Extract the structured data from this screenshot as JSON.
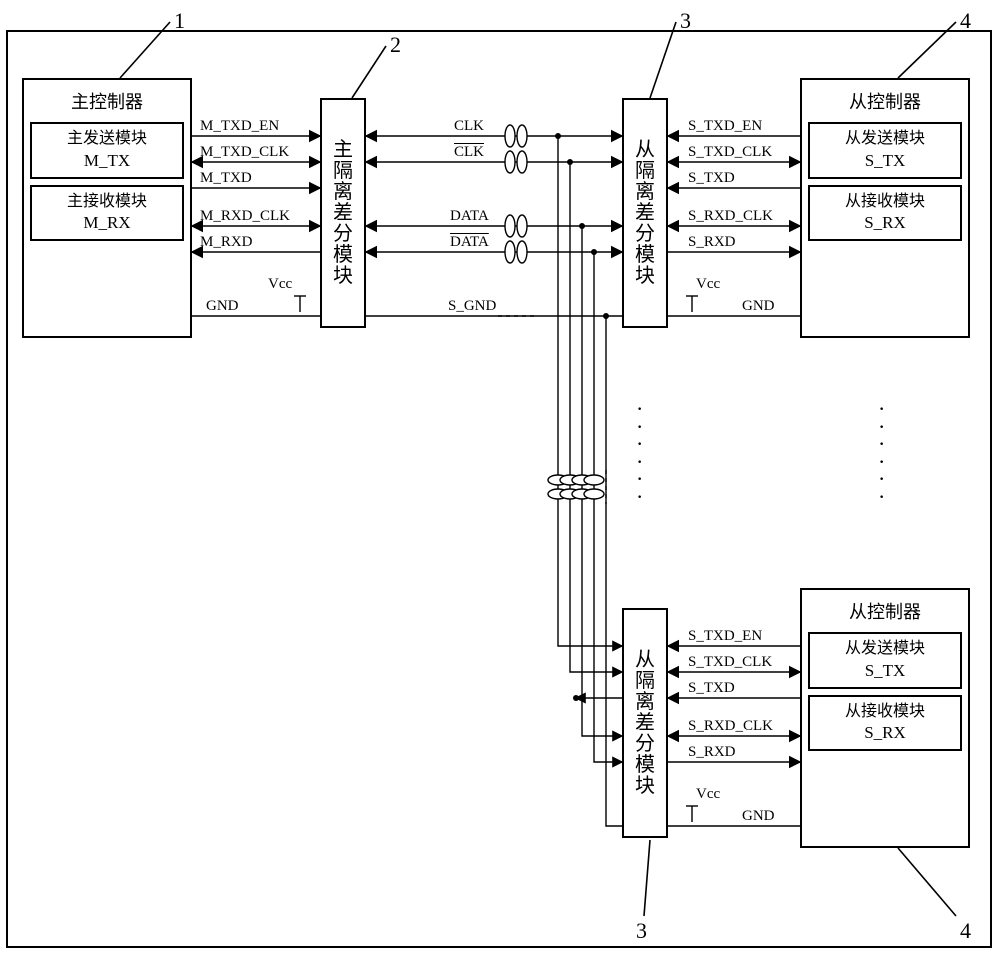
{
  "numbers": {
    "n1": "1",
    "n2": "2",
    "n3": "3",
    "n4": "4"
  },
  "master": {
    "title": "主控制器",
    "tx_t": "主发送模块",
    "tx_c": "M_TX",
    "rx_t": "主接收模块",
    "rx_c": "M_RX"
  },
  "slave": {
    "title": "从控制器",
    "tx_t": "从发送模块",
    "tx_c": "S_TX",
    "rx_t": "从接收模块",
    "rx_c": "S_RX"
  },
  "iso": {
    "master": "主隔离差分模块",
    "slave": "从隔离差分模块"
  },
  "sig": {
    "m_txd_en": "M_TXD_EN",
    "m_txd_clk": "M_TXD_CLK",
    "m_txd": "M_TXD",
    "m_rxd_clk": "M_RXD_CLK",
    "m_rxd": "M_RXD",
    "s_txd_en": "S_TXD_EN",
    "s_txd_clk": "S_TXD_CLK",
    "s_txd": "S_TXD",
    "s_rxd_clk": "S_RXD_CLK",
    "s_rxd": "S_RXD",
    "gnd": "GND",
    "vcc": "Vcc",
    "clk": "CLK",
    "clk_b": "CLK",
    "data": "DATA",
    "data_b": "DATA",
    "s_gnd": "S_GND"
  }
}
